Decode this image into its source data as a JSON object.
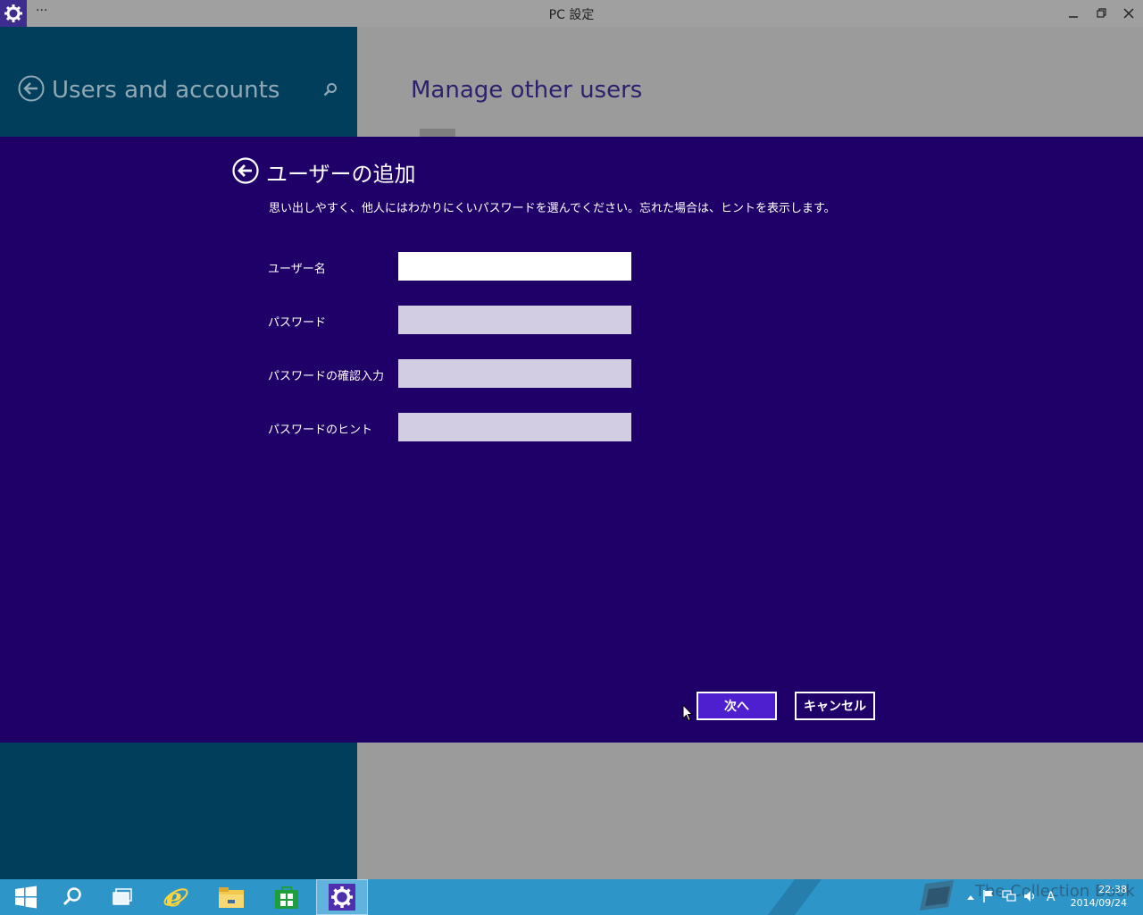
{
  "window": {
    "title": "PC 設定",
    "menu_dots": "···"
  },
  "left_pane": {
    "title": "Users and accounts"
  },
  "right_pane": {
    "title": "Manage other users"
  },
  "dialog": {
    "title": "ユーザーの追加",
    "description": "思い出しやすく、他人にはわかりにくいパスワードを選んでください。忘れた場合は、ヒントを表示します。",
    "fields": [
      {
        "label": "ユーザー名",
        "value": ""
      },
      {
        "label": "パスワード",
        "value": ""
      },
      {
        "label": "パスワードの確認入力",
        "value": ""
      },
      {
        "label": "パスワードのヒント",
        "value": ""
      }
    ],
    "next_label": "次へ",
    "cancel_label": "キャンセル"
  },
  "taskbar": {
    "watermark": "The Collection Book",
    "ime_indicator": "A",
    "time": "22:38",
    "date": "2014/09/24"
  },
  "colors": {
    "dialog_bg": "#1f0068",
    "next_button": "#4d1fcf",
    "left_pane": "#003e5c",
    "taskbar": "#2e95c8"
  }
}
